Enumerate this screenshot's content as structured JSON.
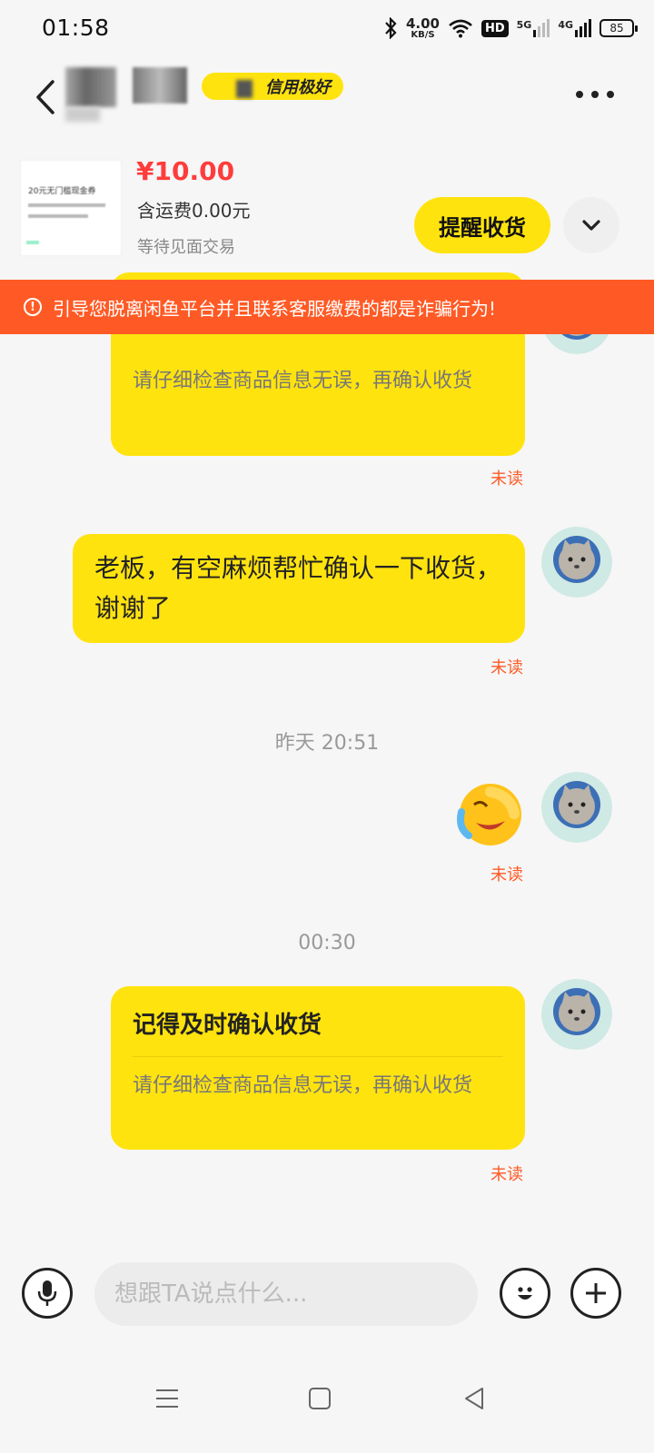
{
  "status_bar": {
    "time": "01:58",
    "net_speed_value": "4.00",
    "net_speed_unit": "KB/S",
    "hd_label": "HD",
    "signal_5g": "5G",
    "signal_4g": "4G",
    "battery_level": "85"
  },
  "header": {
    "credit_badge": "信用极好"
  },
  "product": {
    "thumbnail_text": "20元无门槛现金券",
    "price": "¥10.00",
    "shipping": "含运费0.00元",
    "status": "等待见面交易",
    "remind_button": "提醒收货"
  },
  "warning_banner": {
    "text": "引导您脱离闲鱼平台并且联系客服缴费的都是诈骗行为!"
  },
  "messages": {
    "card_top": {
      "body": "请仔细检查商品信息无误，再确认收货",
      "status": "未读"
    },
    "text_1": {
      "text": "老板，有空麻烦帮忙确认一下收货，谢谢了",
      "status": "未读"
    },
    "time_1": "昨天 20:51",
    "emoji_1": {
      "emoji_name": "crying-laughing",
      "status": "未读"
    },
    "time_2": "00:30",
    "card_bottom": {
      "title": "记得及时确认收货",
      "body": "请仔细检查商品信息无误，再确认收货",
      "status": "未读"
    }
  },
  "input_bar": {
    "placeholder": "想跟TA说点什么..."
  },
  "colors": {
    "brand_yellow": "#ffe30f",
    "warning_orange": "#ff5a25",
    "price_red": "#ff3c3c"
  }
}
